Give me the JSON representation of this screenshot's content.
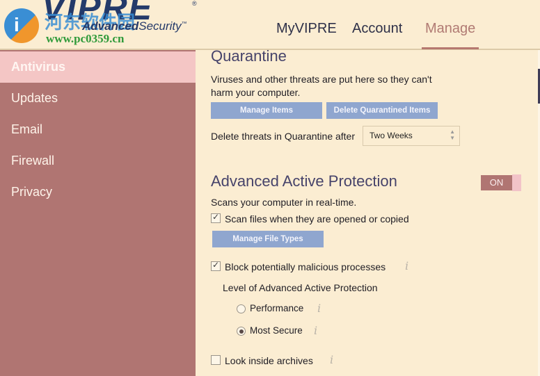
{
  "header": {
    "logo_main": "VIPRE",
    "logo_reg": "®",
    "logo_sub_bold": "Advanced",
    "logo_sub": "Security",
    "logo_tm": "™",
    "watermark_cn": "河东软件园",
    "watermark_url": "www.pc0359.cn",
    "nav": [
      {
        "label": "MyVIPRE",
        "active": false
      },
      {
        "label": "Account",
        "active": false
      },
      {
        "label": "Manage",
        "active": true
      }
    ]
  },
  "sidebar": {
    "items": [
      {
        "label": "Antivirus",
        "active": true
      },
      {
        "label": "Updates",
        "active": false
      },
      {
        "label": "Email",
        "active": false
      },
      {
        "label": "Firewall",
        "active": false
      },
      {
        "label": "Privacy",
        "active": false
      }
    ]
  },
  "quarantine": {
    "title": "Quarantine",
    "description_line1": "Viruses and other threats are put here so they can't",
    "description_line2": "harm your computer.",
    "manage_items_label": "Manage Items",
    "delete_items_label": "Delete Quarantined Items",
    "delete_after_label": "Delete threats in Quarantine after",
    "delete_after_value": "Two Weeks"
  },
  "protection": {
    "title": "Advanced Active Protection",
    "toggle_label": "ON",
    "toggle_state": true,
    "description": "Scans your computer in real-time.",
    "scan_files_label": "Scan files when they are opened or copied",
    "scan_files_checked": true,
    "manage_file_types_label": "Manage File Types",
    "block_processes_label": "Block potentially malicious processes",
    "block_processes_checked": true,
    "level_label": "Level of Advanced Active Protection",
    "levels": [
      {
        "label": "Performance",
        "selected": false
      },
      {
        "label": "Most Secure",
        "selected": true
      }
    ],
    "archives_label": "Look inside archives",
    "archives_checked": false,
    "info_glyph": "i"
  },
  "colors": {
    "background": "#fbedd2",
    "sidebar": "#b07572",
    "sidebar_active": "#f4c6c5",
    "button": "#8fa6cf",
    "heading": "#46436a",
    "nav_active": "#b07a73"
  }
}
